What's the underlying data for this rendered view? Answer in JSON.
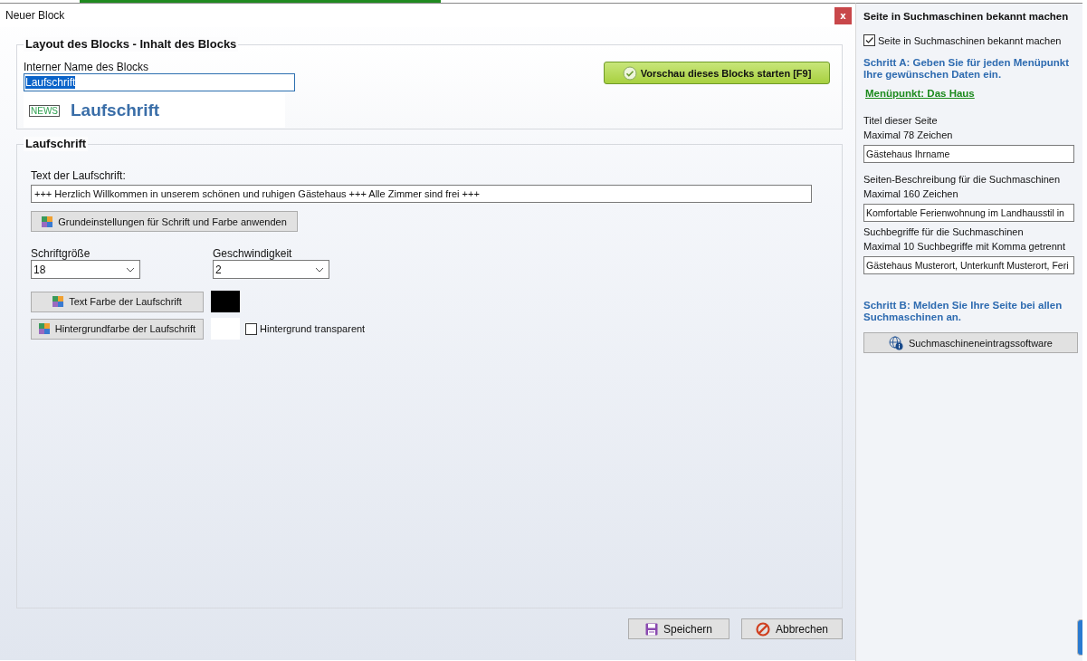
{
  "dialog": {
    "title": "Neuer Block",
    "close": "x"
  },
  "layout_group": {
    "title": "Layout des Blocks - Inhalt des Blocks",
    "name_label": "Interner Name des Blocks",
    "name_value": "Laufschrift",
    "name_selected": true,
    "preview_button": "Vorschau dieses Blocks starten [F9]",
    "badge": "NEWS",
    "preview_text": "Laufschrift"
  },
  "marquee_group": {
    "title": "Laufschrift",
    "text_label": "Text der Laufschrift:",
    "text_value": "+++ Herzlich Willkommen in unserem schönen und ruhigen Gästehaus +++ Alle Zimmer sind frei +++",
    "defaults_button": "Grundeinstellungen für Schrift und Farbe anwenden",
    "dropdowns": [
      {
        "label": "Schriftgröße",
        "value": "18"
      },
      {
        "label": "Geschwindigkeit",
        "value": "2"
      }
    ],
    "color_rows": [
      {
        "button": "Text Farbe der Laufschrift",
        "color": "#000000"
      },
      {
        "button": "Hintergrundfarbe der Laufschrift",
        "color": "#ffffff"
      }
    ],
    "transparent": {
      "label": "Hintergrund transparent",
      "checked": false
    }
  },
  "buttons": [
    {
      "kind": "save",
      "label": "Speichern"
    },
    {
      "kind": "cancel",
      "label": "Abbrechen"
    }
  ],
  "seo_panel": {
    "title": "Seite in Suchmaschinen bekannt machen",
    "enable": {
      "label": "Seite in Suchmaschinen bekannt machen",
      "checked": true
    },
    "step_a": "Schritt A: Geben Sie für jeden Menüpunkt Ihre gewünschen Daten ein.",
    "menu_link": "Menüpunkt: Das Haus",
    "fields": [
      {
        "label": "Titel dieser Seite",
        "hint": "Maximal 78 Zeichen",
        "value": "Gästehaus Ihrname"
      },
      {
        "label": "Seiten-Beschreibung für die Suchmaschinen",
        "hint": "Maximal 160 Zeichen",
        "value": "Komfortable Ferienwohnung im Landhausstil in"
      },
      {
        "label": "Suchbegriffe für die Suchmaschinen",
        "hint": "Maximal 10 Suchbegriffe mit Komma getrennt",
        "value": "Gästehaus Musterort, Unterkunft Musterort, Feri"
      }
    ],
    "step_b": "Schritt B: Melden Sie Ihre Seite bei allen Suchmaschinen an.",
    "software_button": "Suchmaschineneintragssoftware"
  }
}
